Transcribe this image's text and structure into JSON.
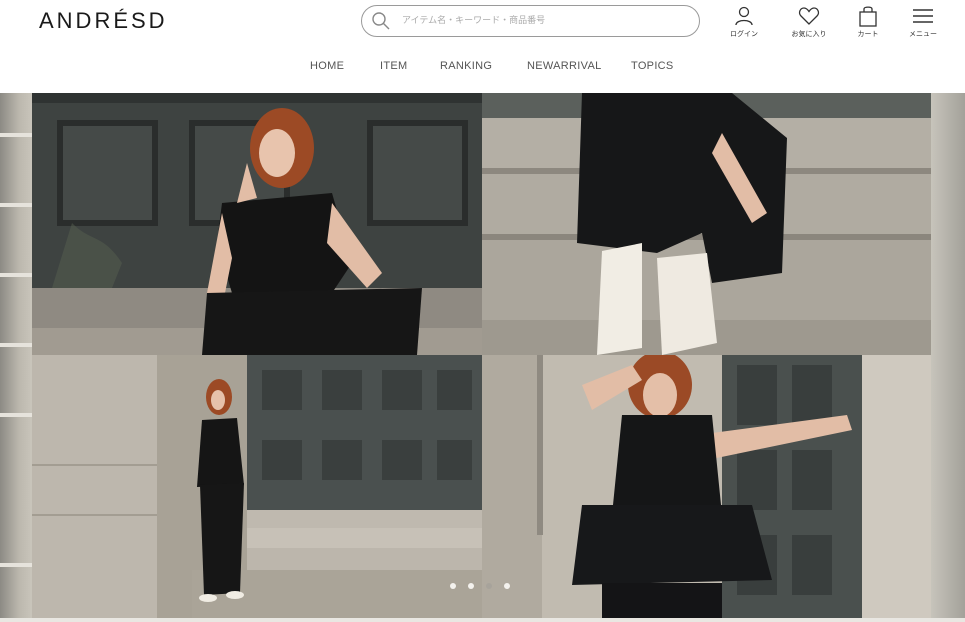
{
  "header": {
    "logo": "ANDRÉSD",
    "search": {
      "placeholder": "アイテム名・キーワード・商品番号",
      "value": ""
    },
    "icons": [
      {
        "name": "user-icon",
        "label": "ログイン"
      },
      {
        "name": "heart-icon",
        "label": "お気に入り"
      },
      {
        "name": "bag-icon",
        "label": "カート"
      },
      {
        "name": "hamburger-icon",
        "label": "メニュー"
      }
    ]
  },
  "nav": {
    "items": [
      "HOME",
      "ITEM",
      "RANKING",
      "NEWARRIVAL",
      "TOPICS"
    ]
  },
  "hero": {
    "slide_count": 4,
    "active_slide": 1
  },
  "colors": {
    "text": "#222222",
    "nav_text": "#555555",
    "search_border": "#9a9a9a"
  }
}
